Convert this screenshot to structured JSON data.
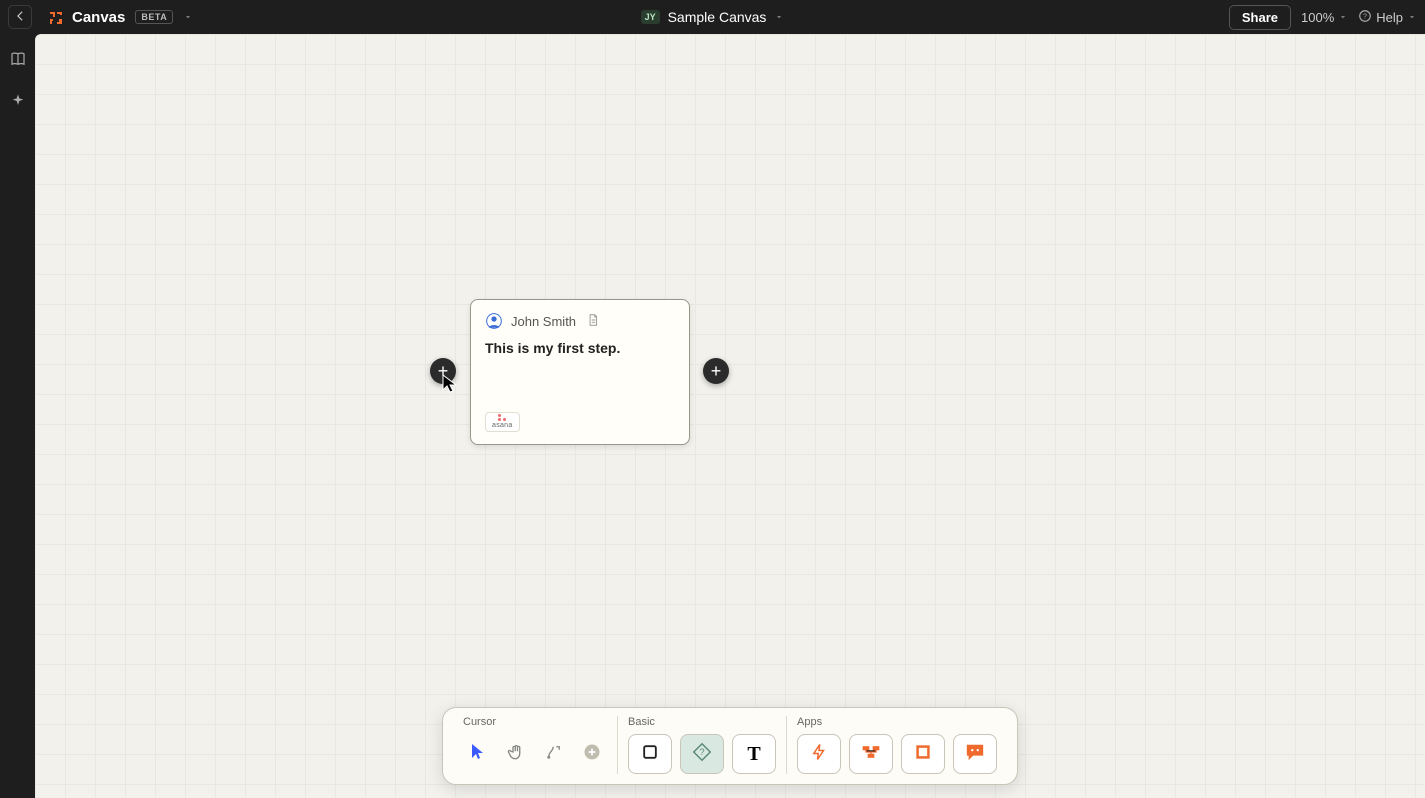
{
  "header": {
    "app_name": "Canvas",
    "beta_label": "BETA",
    "user_initials": "JY",
    "document_title": "Sample Canvas",
    "share_label": "Share",
    "zoom_label": "100%",
    "help_label": "Help"
  },
  "card": {
    "author": "John Smith",
    "body": "This is my first step.",
    "app_chip_label": "asana"
  },
  "toolbar": {
    "groups": {
      "cursor": {
        "label": "Cursor"
      },
      "basic": {
        "label": "Basic"
      },
      "apps": {
        "label": "Apps"
      }
    }
  }
}
